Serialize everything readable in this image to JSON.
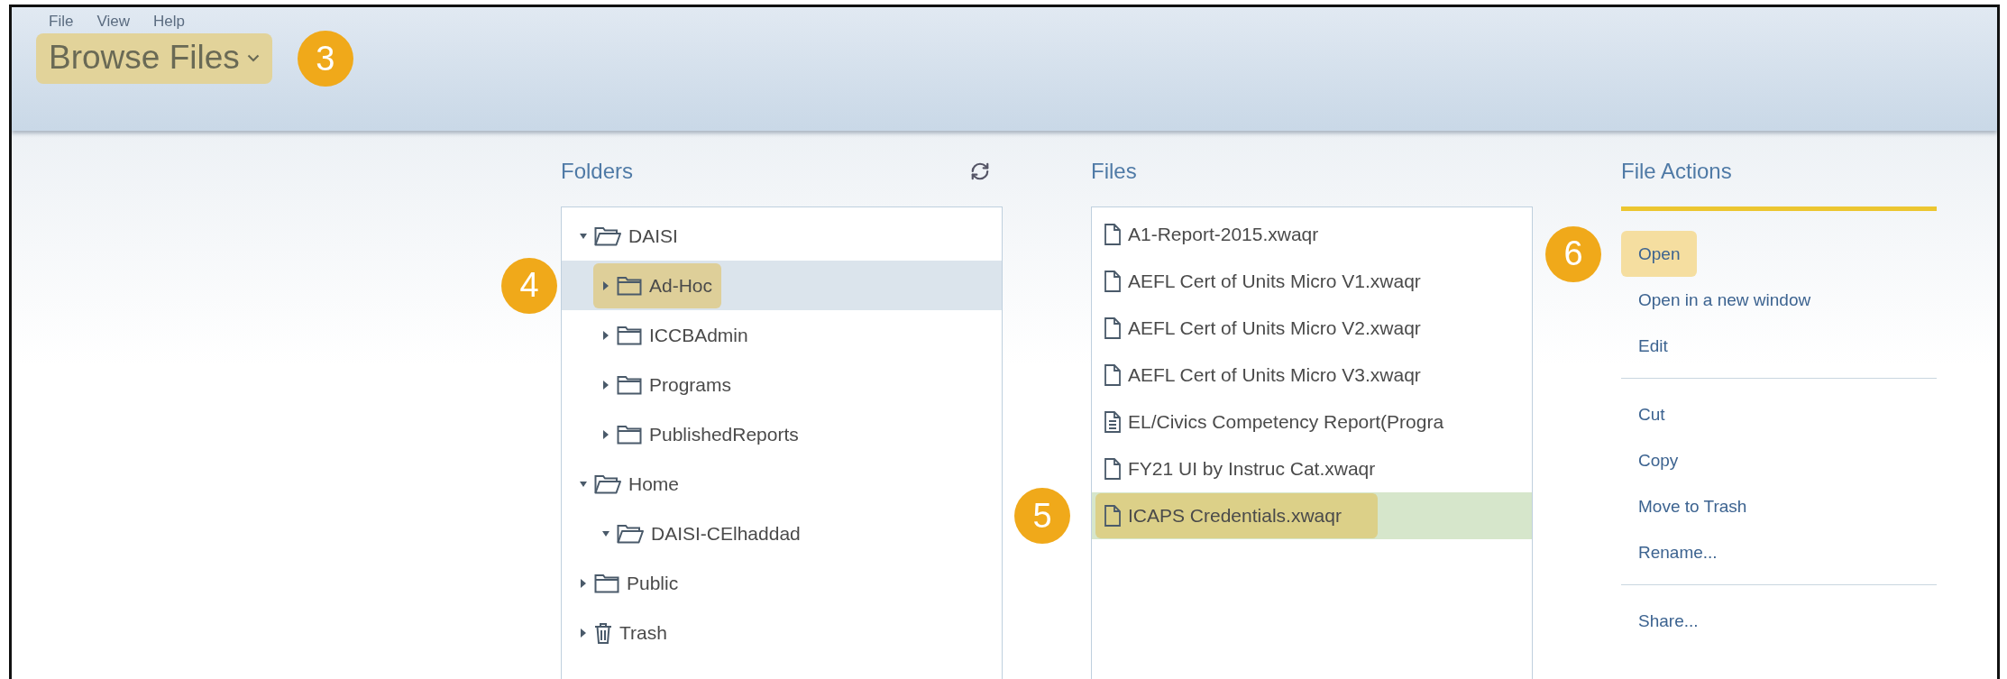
{
  "menu": [
    {
      "label": "File"
    },
    {
      "label": "View"
    },
    {
      "label": "Help"
    }
  ],
  "perspective": {
    "label": "Browse Files",
    "highlighted": true,
    "callout": "3"
  },
  "folders": {
    "title": "Folders",
    "tree": [
      {
        "name": "DAISI",
        "kind": "folder",
        "expanded": true,
        "selected": false,
        "highlighted": false,
        "children": [
          {
            "name": "Ad-Hoc",
            "kind": "folder",
            "expanded": false,
            "selected": true,
            "highlighted": true,
            "callout": "4"
          },
          {
            "name": "ICCBAdmin",
            "kind": "folder",
            "expanded": false,
            "selected": false,
            "highlighted": false
          },
          {
            "name": "Programs",
            "kind": "folder",
            "expanded": false,
            "selected": false,
            "highlighted": false
          },
          {
            "name": "PublishedReports",
            "kind": "folder",
            "expanded": false,
            "selected": false,
            "highlighted": false
          }
        ]
      },
      {
        "name": "Home",
        "kind": "folder",
        "expanded": true,
        "selected": false,
        "highlighted": false,
        "children": [
          {
            "name": "DAISI-CElhaddad",
            "kind": "folder",
            "expanded": true,
            "selected": false,
            "highlighted": false
          }
        ]
      },
      {
        "name": "Public",
        "kind": "folder",
        "expanded": false,
        "selected": false,
        "highlighted": false
      },
      {
        "name": "Trash",
        "kind": "trash",
        "expanded": false,
        "selected": false,
        "highlighted": false
      }
    ]
  },
  "files": {
    "title": "Files",
    "items": [
      {
        "name": "A1-Report-2015.xwaqr",
        "kind": "blank",
        "selected": false,
        "highlighted": false
      },
      {
        "name": "AEFL Cert of Units Micro V1.xwaqr",
        "kind": "blank",
        "selected": false,
        "highlighted": false
      },
      {
        "name": "AEFL Cert of Units Micro V2.xwaqr",
        "kind": "blank",
        "selected": false,
        "highlighted": false
      },
      {
        "name": "AEFL Cert of Units Micro V3.xwaqr",
        "kind": "blank",
        "selected": false,
        "highlighted": false
      },
      {
        "name": "EL/Civics Competency Report(Progra",
        "kind": "text",
        "selected": false,
        "highlighted": false
      },
      {
        "name": "FY21 UI by Instruc Cat.xwaqr",
        "kind": "blank",
        "selected": false,
        "highlighted": false
      },
      {
        "name": "ICAPS Credentials.xwaqr",
        "kind": "blank",
        "selected": true,
        "highlighted": true,
        "callout": "5"
      }
    ]
  },
  "file_actions": {
    "title": "File Actions",
    "groups": [
      {
        "items": [
          {
            "label": "Open",
            "highlighted": true,
            "callout": "6"
          },
          {
            "label": "Open in a new window",
            "highlighted": false
          },
          {
            "label": "Edit",
            "highlighted": false
          }
        ]
      },
      {
        "items": [
          {
            "label": "Cut",
            "highlighted": false
          },
          {
            "label": "Copy",
            "highlighted": false
          },
          {
            "label": "Move to Trash",
            "highlighted": false
          },
          {
            "label": "Rename...",
            "highlighted": false
          }
        ]
      },
      {
        "items": [
          {
            "label": "Share...",
            "highlighted": false
          }
        ]
      }
    ]
  }
}
